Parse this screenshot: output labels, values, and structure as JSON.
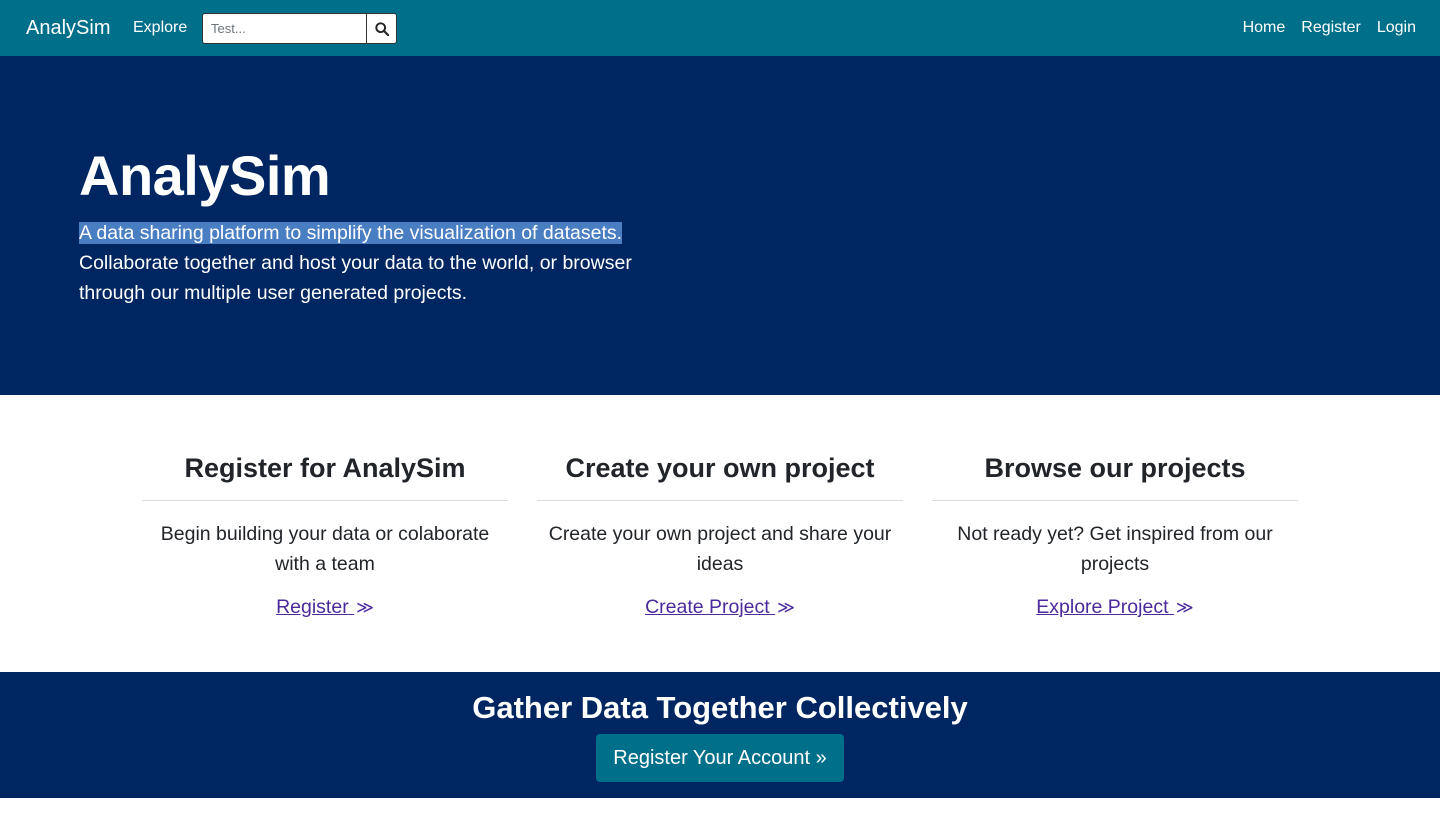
{
  "navbar": {
    "brand": "AnalySim",
    "explore": "Explore",
    "search_placeholder": "Test...",
    "search_icon": "search-icon",
    "links": [
      "Home",
      "Register",
      "Login"
    ]
  },
  "hero": {
    "title": "AnalySim",
    "highlighted_text": "A data sharing platform to simplify the visualization of datasets.",
    "text": "Collaborate together and host your data to the world, or browser through our multiple user generated projects."
  },
  "features": [
    {
      "title": "Register for AnalySim",
      "description": "Begin building your data or colaborate with a team",
      "link": "Register",
      "link_icon": "chevron-double-right-icon"
    },
    {
      "title": "Create your own project",
      "description": "Create your own project and share your ideas",
      "link": "Create Project",
      "link_icon": "chevron-double-right-icon"
    },
    {
      "title": "Browse our projects",
      "description": "Not ready yet? Get inspired from our projects",
      "link": "Explore Project",
      "link_icon": "chevron-double-right-icon"
    }
  ],
  "cta": {
    "title": "Gather Data Together Collectively",
    "button": "Register Your Account »"
  },
  "colors": {
    "navbar": "#00708a",
    "hero": "#002661",
    "link": "#4b2a9c",
    "highlight": "#4a7ec2"
  }
}
